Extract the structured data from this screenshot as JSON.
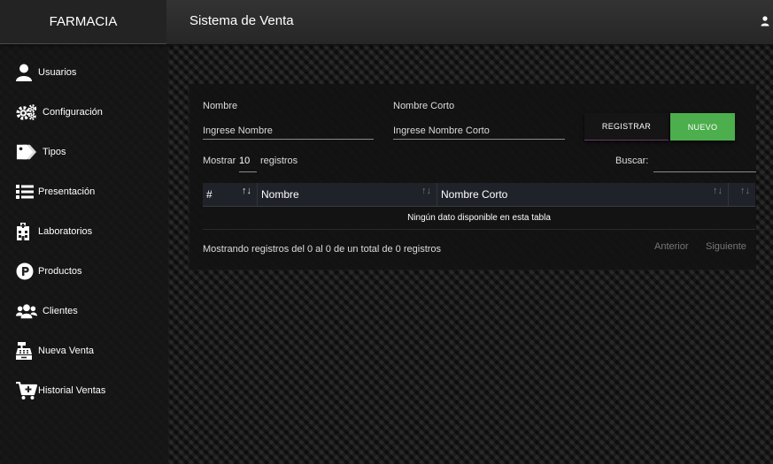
{
  "header": {
    "brand": "FARMACIA",
    "title": "Sistema de Venta"
  },
  "sidebar": {
    "items": [
      {
        "label": "Usuarios",
        "icon": "user-icon"
      },
      {
        "label": "Configuración",
        "icon": "gears-icon"
      },
      {
        "label": "Tipos",
        "icon": "tags-icon"
      },
      {
        "label": "Presentación",
        "icon": "list-icon"
      },
      {
        "label": "Laboratorios",
        "icon": "hospital-icon"
      },
      {
        "label": "Productos",
        "icon": "parking-icon"
      },
      {
        "label": "Clientes",
        "icon": "users-icon"
      },
      {
        "label": "Nueva Venta",
        "icon": "cash-register-icon"
      },
      {
        "label": "Historial Ventas",
        "icon": "cart-plus-icon"
      }
    ]
  },
  "form": {
    "nombre_label": "Nombre",
    "nombre_placeholder": "Ingrese Nombre",
    "nombre_value": "",
    "nombre_corto_label": "Nombre Corto",
    "nombre_corto_placeholder": "Ingrese Nombre Corto",
    "nombre_corto_value": "",
    "registrar_label": "REGISTRAR",
    "nuevo_label": "NUEVO"
  },
  "table_controls": {
    "show_prefix": "Mostrar",
    "page_length": "10",
    "show_suffix": "registros",
    "search_label": "Buscar:",
    "search_value": ""
  },
  "table": {
    "columns": [
      "#",
      "Nombre",
      "Nombre Corto",
      ""
    ],
    "empty_message": "Ningún dato disponible en esta tabla",
    "info": "Mostrando registros del 0 al 0 de un total de 0 registros",
    "prev_label": "Anterior",
    "next_label": "Siguiente"
  },
  "colors": {
    "accent_green": "#4cae4c",
    "topbar": "#2c2c2c",
    "table_header": "#1f2329"
  }
}
